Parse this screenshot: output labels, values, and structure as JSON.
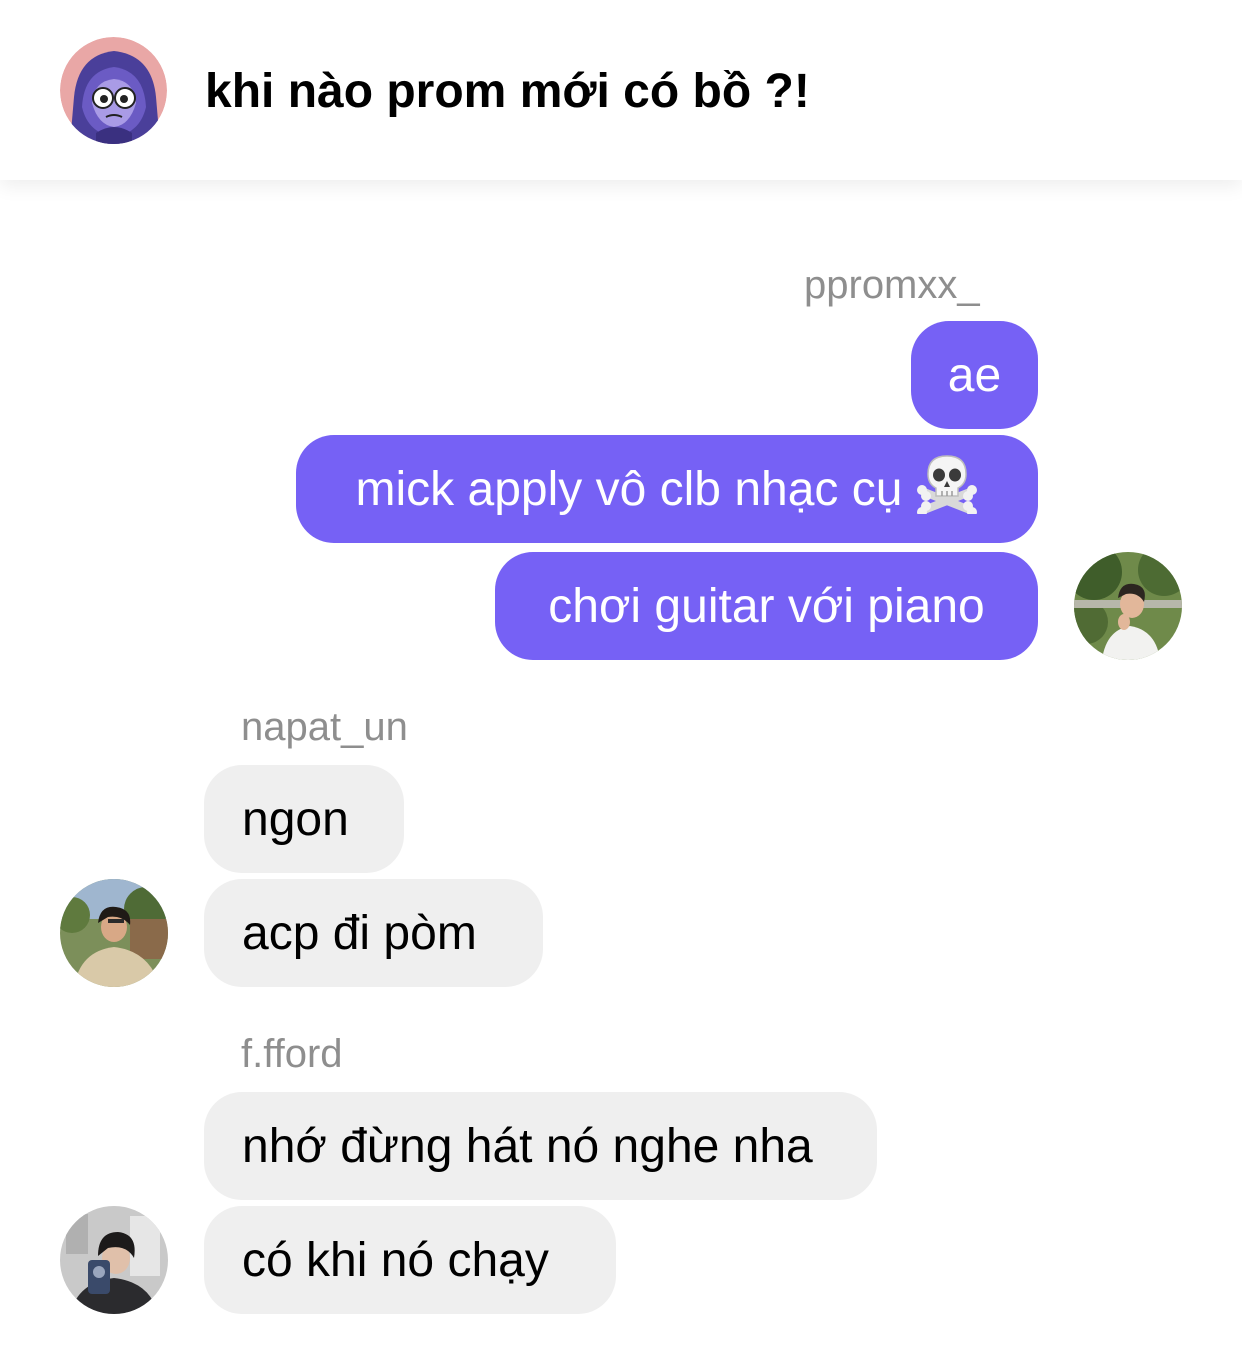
{
  "header": {
    "title": "khi nào prom mới có bồ ?!",
    "avatar_icon": "hooded-cartoon-avatar"
  },
  "messages": {
    "group1": {
      "sender": "ppromxx_",
      "bubbles": [
        "ae",
        "mick apply vô clb nhạc cụ",
        "chơi guitar với piano"
      ],
      "emoji_icon": "skull-crossbones-emoji"
    },
    "group2": {
      "sender": "napat_un",
      "bubbles": [
        "ngon",
        "acp đi pòm"
      ]
    },
    "group3": {
      "sender": "f.fford",
      "bubbles": [
        "nhớ đừng hát nó nghe nha",
        "có khi nó chạy"
      ]
    }
  },
  "colors": {
    "outgoing_bubble": "#7661f5",
    "incoming_bubble": "#efefef",
    "sender_name": "#8e8e8e"
  }
}
